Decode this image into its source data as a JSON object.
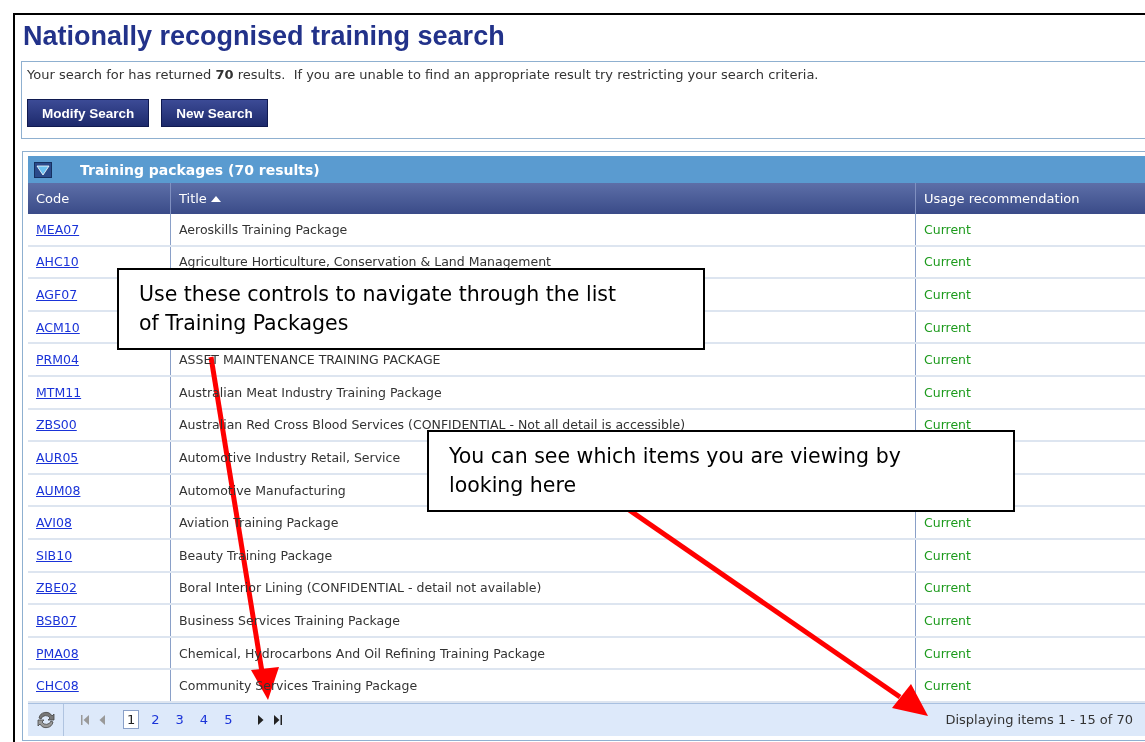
{
  "page_title": "Nationally recognised training search",
  "summary": "Your search for has returned **70** results.  If you are unable to find an appropriate result try restricting your search criteria.",
  "buttons": [
    "Modify Search",
    "New Search"
  ],
  "panel": {
    "title": "Training packages (70 results)",
    "expanded": true
  },
  "table": {
    "columns": [
      {
        "label": "Code",
        "sorted": false
      },
      {
        "label": "Title",
        "sorted": true
      },
      {
        "label": "Usage recommendation",
        "sorted": false
      }
    ],
    "rows": [
      {
        "code": "MEA07",
        "title": "Aeroskills Training Package",
        "usage": "Current"
      },
      {
        "code": "AHC10",
        "title": "Agriculture Horticulture, Conservation & Land Management",
        "usage": "Current"
      },
      {
        "code": "AGF07",
        "usage": "Current"
      },
      {
        "code": "ACM10",
        "usage": "Current"
      },
      {
        "code": "PRM04",
        "title": "ASSET MAINTENANCE TRAINING PACKAGE",
        "usage": "Current"
      },
      {
        "code": "MTM11",
        "title": "Australian Meat Industry Training Package",
        "usage": "Current"
      },
      {
        "code": "ZBS00",
        "title": "Australian Red Cross Blood Services (CONFIDENTIAL - Not all detail is accessible)",
        "usage": "Current"
      },
      {
        "code": "AUR05",
        "title": "Automotive Industry Retail, Service"
      },
      {
        "code": "AUM08",
        "title": "Automotive Manufacturing"
      },
      {
        "code": "AVI08",
        "title": "Aviation Training Package",
        "usage": "Current"
      },
      {
        "code": "SIB10",
        "title": "Beauty Training Package",
        "usage": "Current"
      },
      {
        "code": "ZBE02",
        "title": "Boral Interior Lining (CONFIDENTIAL - detail not available)",
        "usage": "Current"
      },
      {
        "code": "BSB07",
        "title": "Business Services Training Package",
        "usage": "Current"
      },
      {
        "code": "PMA08",
        "title": "Chemical, Hydrocarbons And Oil Refining Training Package",
        "usage": "Current"
      },
      {
        "code": "CHC08",
        "title": "Community Services Training Package",
        "usage": "Current"
      }
    ]
  },
  "pager": {
    "pages": [
      {
        "label": "1",
        "selected": true
      },
      {
        "label": "2",
        "selected": false
      },
      {
        "label": "3",
        "selected": false
      },
      {
        "label": "4",
        "selected": false
      },
      {
        "label": "5",
        "selected": false
      }
    ],
    "status": "Displaying items 1 - 15 of 70"
  },
  "callouts": [
    "Use these controls to navigate through the list of Training Packages",
    "You can see which items you are viewing by looking here"
  ]
}
